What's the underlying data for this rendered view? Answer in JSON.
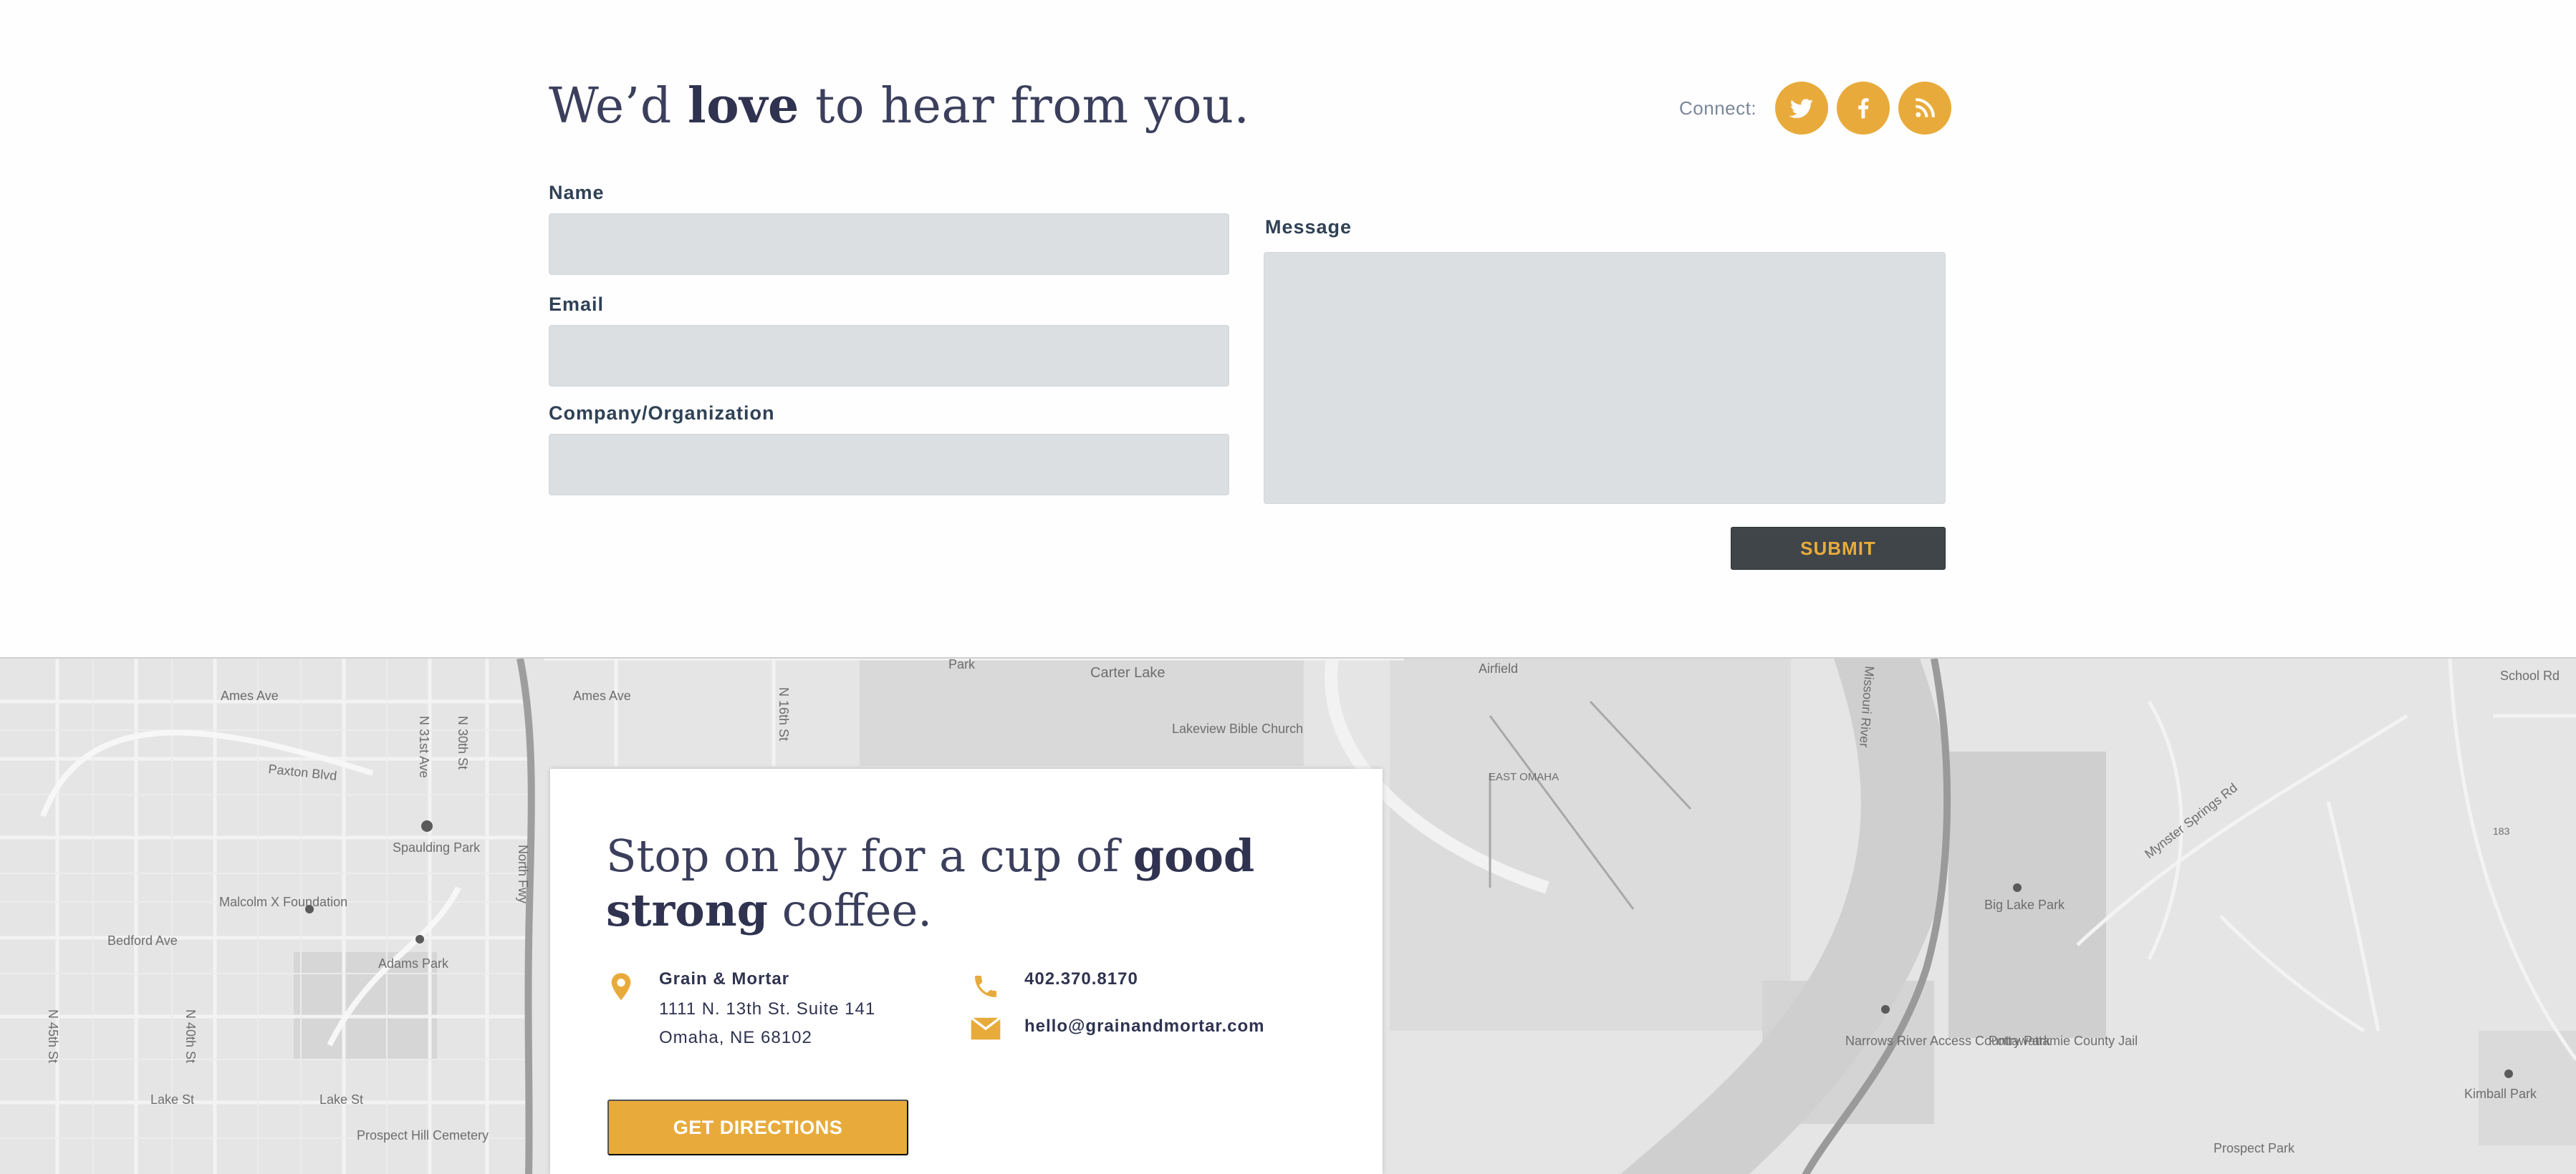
{
  "contact": {
    "headline_pre": "We’d ",
    "headline_bold": "love",
    "headline_post": " to hear from you.",
    "connect_label": "Connect:",
    "social": [
      {
        "name": "twitter-icon"
      },
      {
        "name": "facebook-icon"
      },
      {
        "name": "rss-icon"
      }
    ],
    "fields": {
      "name_label": "Name",
      "name_value": "",
      "email_label": "Email",
      "email_value": "",
      "company_label": "Company/Organization",
      "company_value": "",
      "message_label": "Message",
      "message_value": ""
    },
    "submit_label": "SUBMIT"
  },
  "map": {
    "labels": [
      "Ames Ave",
      "Ames Ave",
      "Paxton Blvd",
      "N 31st Ave",
      "N 30th St",
      "N 16th St",
      "Carter Lake",
      "Lakeview Bible Church",
      "Airfield",
      "EAST OMAHA",
      "Missouri River",
      "Spaulding Park",
      "Malcolm X Foundation",
      "Bedford Ave",
      "Adams Park",
      "North Fwy",
      "N 45th St",
      "N 40th St",
      "Lake St",
      "Lake St",
      "Prospect Hill Cemetery",
      "Big Lake Park",
      "Narrows River Access Country Park",
      "Pottawattamie County Jail",
      "Mynster Springs Rd",
      "Kimball Park",
      "Prospect Park",
      "School Rd",
      "Park",
      "183"
    ]
  },
  "card": {
    "title_pre": "Stop on by for a cup of ",
    "title_bold1": "good",
    "title_bold2": "strong",
    "title_post": " coffee.",
    "business_name": "Grain & Mortar",
    "address_line1": "1111 N. 13th St. Suite 141",
    "address_line2": "Omaha, NE 68102",
    "phone": "402.370.8170",
    "email": "hello@grainandmortar.com",
    "directions_label": "GET DIRECTIONS"
  },
  "colors": {
    "accent": "#e8ab3b",
    "dark_button": "#3f4548",
    "heading": "#3b3f5c",
    "field_bg": "#dcdfe1",
    "map_bg": "#e4e4e4"
  }
}
